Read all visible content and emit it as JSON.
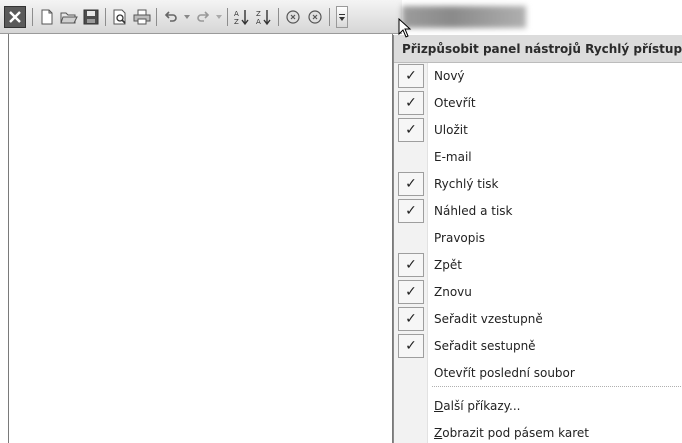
{
  "toolbar": {
    "buttons": [
      {
        "name": "excel-logo",
        "icon": "excel-icon"
      },
      {
        "name": "new-button",
        "icon": "new-document-icon"
      },
      {
        "name": "open-button",
        "icon": "open-folder-icon"
      },
      {
        "name": "save-button",
        "icon": "save-icon"
      },
      {
        "name": "print-preview-button",
        "icon": "print-preview-icon"
      },
      {
        "name": "quick-print-button",
        "icon": "printer-icon"
      },
      {
        "name": "undo-button",
        "icon": "undo-icon"
      },
      {
        "name": "redo-button",
        "icon": "redo-icon"
      },
      {
        "name": "sort-ascending-button",
        "icon": "sort-ascending-icon"
      },
      {
        "name": "sort-descending-button",
        "icon": "sort-descending-icon"
      },
      {
        "name": "macro-button-1",
        "icon": "circle-icon"
      },
      {
        "name": "macro-button-2",
        "icon": "circle-icon"
      },
      {
        "name": "customize-qat-button",
        "icon": "chevron-down-icon"
      }
    ]
  },
  "menu": {
    "header": "Přizpůsobit panel nástrojů Rychlý přístup",
    "items": [
      {
        "label": "Nový",
        "checked": true
      },
      {
        "label": "Otevřít",
        "checked": true
      },
      {
        "label": "Uložit",
        "checked": true
      },
      {
        "label": "E-mail",
        "checked": false
      },
      {
        "label": "Rychlý tisk",
        "checked": true
      },
      {
        "label": "Náhled a tisk",
        "checked": true
      },
      {
        "label": "Pravopis",
        "checked": false
      },
      {
        "label": "Zpět",
        "checked": true
      },
      {
        "label": "Znovu",
        "checked": true
      },
      {
        "label": "Seřadit vzestupně",
        "checked": true
      },
      {
        "label": "Seřadit sestupně",
        "checked": true
      },
      {
        "label": "Otevřít poslední soubor",
        "checked": false
      }
    ],
    "more_commands": "Další příkazy...",
    "show_below_ribbon": "Zobrazit pod pásem karet",
    "check_glyph": "✓"
  },
  "colors": {
    "toolbar_bg": "#dcdcdc",
    "menu_header_bg": "#dcdcdc",
    "menu_gutter_bg": "#f2f2f2"
  }
}
